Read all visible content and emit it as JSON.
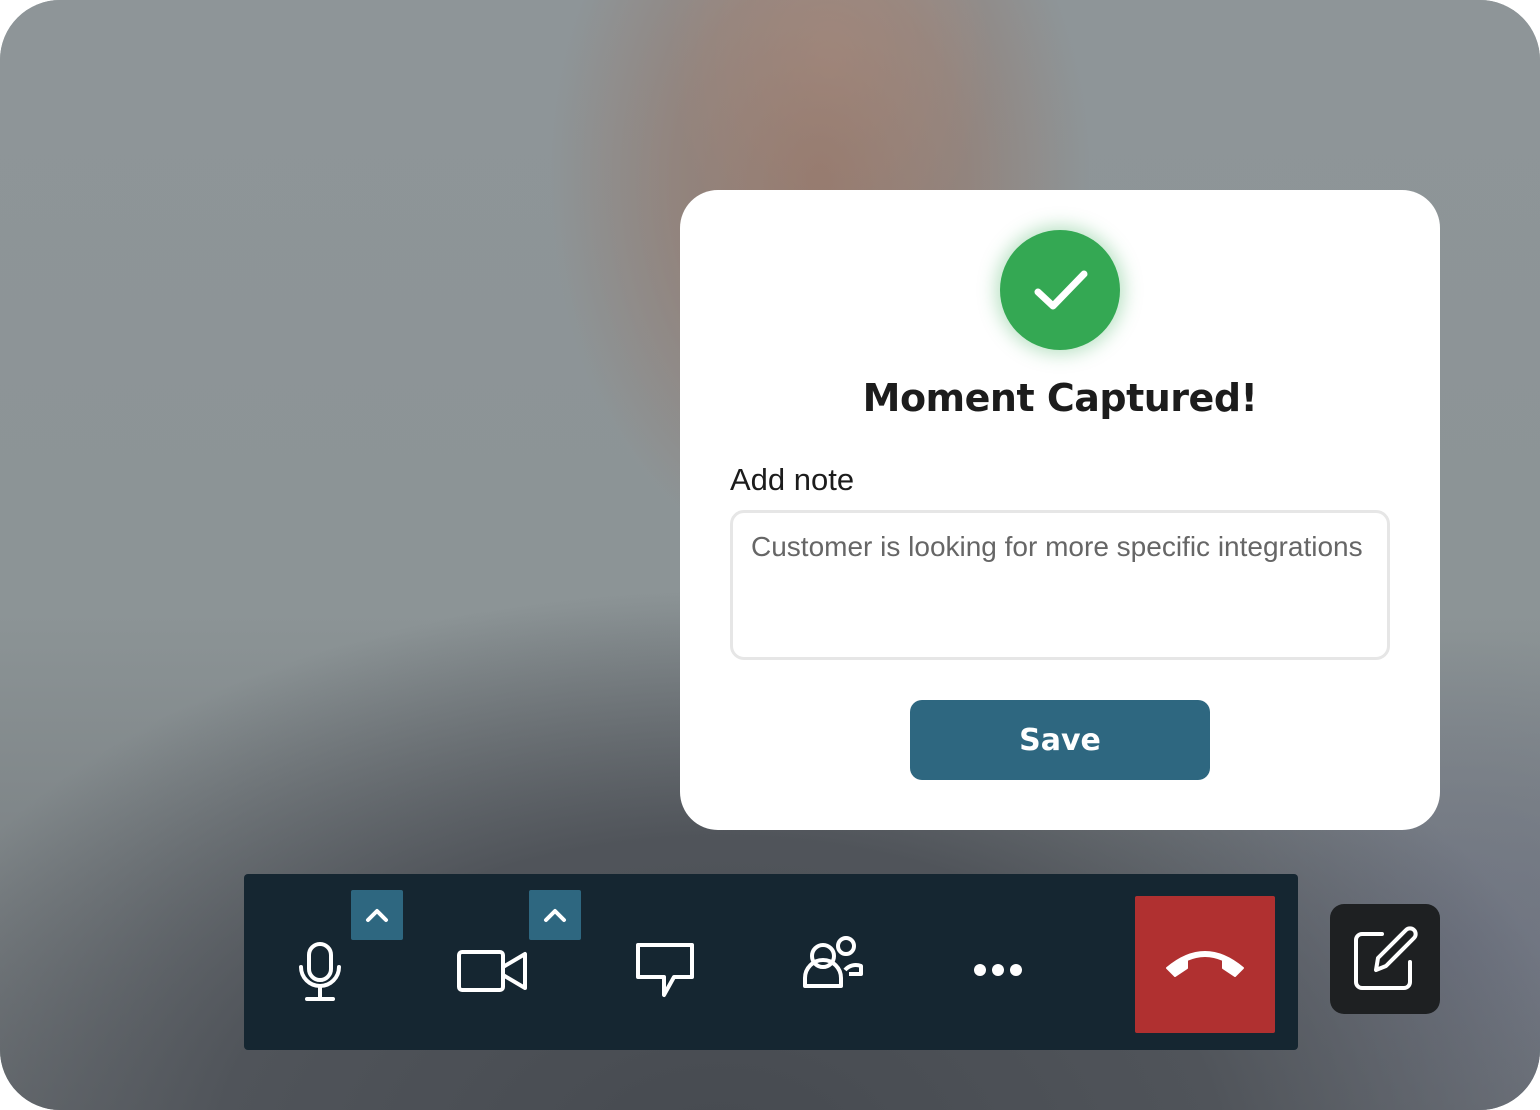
{
  "dialog": {
    "title": "Moment Captured!",
    "note_label": "Add note",
    "note_value": "Customer is looking for more specific integrations",
    "save_label": "Save",
    "success_icon": "checkmark-icon"
  },
  "toolbar": {
    "buttons": [
      {
        "name": "microphone",
        "icon": "microphone-icon",
        "has_menu": true
      },
      {
        "name": "camera",
        "icon": "video-camera-icon",
        "has_menu": true
      },
      {
        "name": "chat",
        "icon": "chat-bubble-icon",
        "has_menu": false
      },
      {
        "name": "participants",
        "icon": "people-icon",
        "has_menu": false
      },
      {
        "name": "more",
        "icon": "more-dots-icon",
        "has_menu": false
      },
      {
        "name": "end-call",
        "icon": "phone-hangup-icon",
        "has_menu": false
      }
    ],
    "edit_icon": "edit-note-icon"
  },
  "colors": {
    "success": "#34a853",
    "primary": "#2e6780",
    "toolbar_bg": "#152631",
    "end_call": "#b03030",
    "edit_bg": "#1e2022"
  }
}
